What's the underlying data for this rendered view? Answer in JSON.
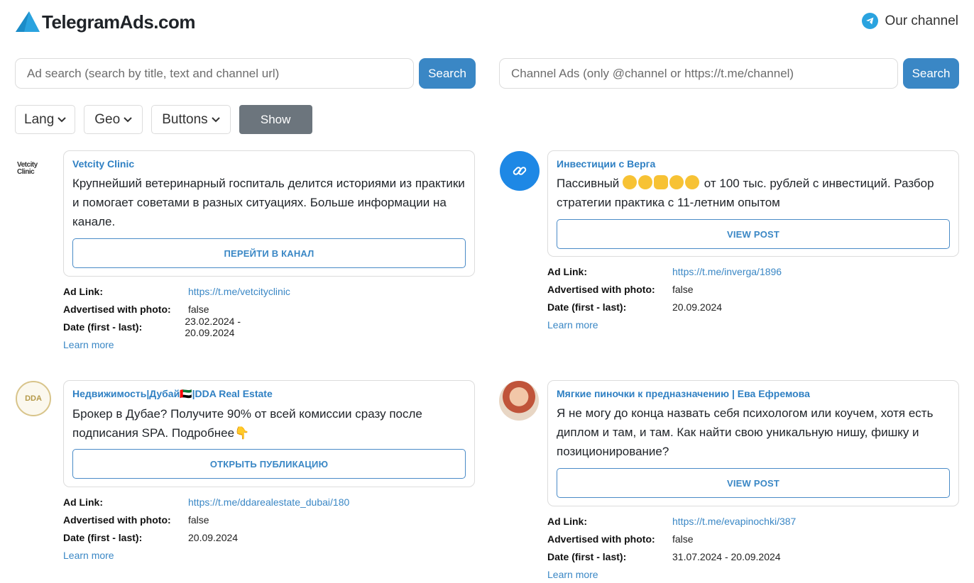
{
  "header": {
    "logo_text": "TelegramAds.com",
    "our_channel": "Our channel"
  },
  "search": {
    "ad_placeholder": "Ad search (search by title, text and channel url)",
    "ad_button": "Search",
    "channel_placeholder": "Channel Ads (only @channel or https://t.me/channel)",
    "channel_button": "Search"
  },
  "filters": {
    "lang": "Lang",
    "geo": "Geo",
    "buttons": "Buttons",
    "show": "Show"
  },
  "labels": {
    "ad_link": "Ad Link:",
    "photo": "Advertised with photo:",
    "date": "Date (first - last):",
    "learn_more": "Learn more"
  },
  "ads": [
    {
      "title": "Vetcity Clinic",
      "text": "Крупнейший ветеринарный госпиталь делится историями из практики и помогает советами в разных ситуациях. Больше информации на канале.",
      "button": "ПЕРЕЙТИ В КАНАЛ",
      "link": "https://t.me/vetcityclinic",
      "photo": "false",
      "date": "23.02.2024 - 20.09.2024",
      "avatar_text": "Vetcity Clinic"
    },
    {
      "title": "Инвестиции с Верга",
      "text_before": "Пассивный",
      "text_after": "от 100 тыс. рублей с инвестиций. Разбор стратегии практика с 11-летним опытом",
      "button": "VIEW POST",
      "link": "https://t.me/inverga/1896",
      "photo": "false",
      "date": "20.09.2024"
    },
    {
      "title": "Недвижимость|Дубай🇦🇪|DDA Real Estate",
      "text": "Брокер в Дубае? Получите 90% от всей комиссии сразу после подписания SPA. Подробнее👇",
      "button": "ОТКРЫТЬ ПУБЛИКАЦИЮ",
      "link": "https://t.me/ddarealestate_dubai/180",
      "photo": "false",
      "date": "20.09.2024",
      "avatar_text": "DDA"
    },
    {
      "title": "Мягкие пиночки к предназначению | Ева Ефремова",
      "text": "Я не могу до конца назвать себя психологом или коучем, хотя есть диплом и там, и там. Как найти свою уникальную нишу, фишку и позиционирование?",
      "button": "VIEW POST",
      "link": "https://t.me/evapinochki/387",
      "photo": "false",
      "date": "31.07.2024 - 20.09.2024"
    }
  ],
  "colors": {
    "accent": "#3a87c5",
    "link": "#2f80c3",
    "show_button": "#6c757d",
    "telegram": "#2aa3df"
  }
}
